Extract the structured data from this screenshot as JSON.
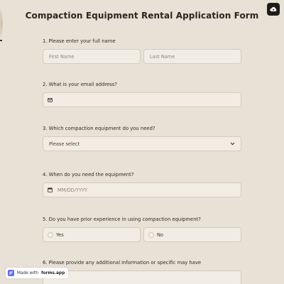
{
  "form": {
    "title": "Compaction Equipment Rental Application Form"
  },
  "top_right": {
    "icon": "cloud-upload-icon"
  },
  "questions": [
    {
      "label": "1.  Please enter your full name",
      "first_name_placeholder": "First Name",
      "last_name_placeholder": "Last Name"
    },
    {
      "label": "2.  What is your email address?",
      "icon": "envelope-icon",
      "value": ""
    },
    {
      "label": "3.  Which compaction equipment do you need?",
      "selected": "Please select",
      "icon": "chevron-down-icon"
    },
    {
      "label": "4.  When do you need the equipment?",
      "icon": "calendar-icon",
      "placeholder": "MM/DD/YYYY"
    },
    {
      "label": "5.  Do you have prior experience in using compaction equipment?",
      "options": [
        "Yes",
        "No"
      ]
    },
    {
      "label": "6.  Please provide any additional information or specific may have"
    }
  ],
  "footer": {
    "made_with": "Made with",
    "brand": "forms.app"
  },
  "colors": {
    "background": "#e8e1d6",
    "field_background": "#f2ede4",
    "field_border": "#d3cbbf",
    "text": "#2f2a24",
    "placeholder": "#8e877e",
    "cloud_button": "#1f1c19"
  }
}
